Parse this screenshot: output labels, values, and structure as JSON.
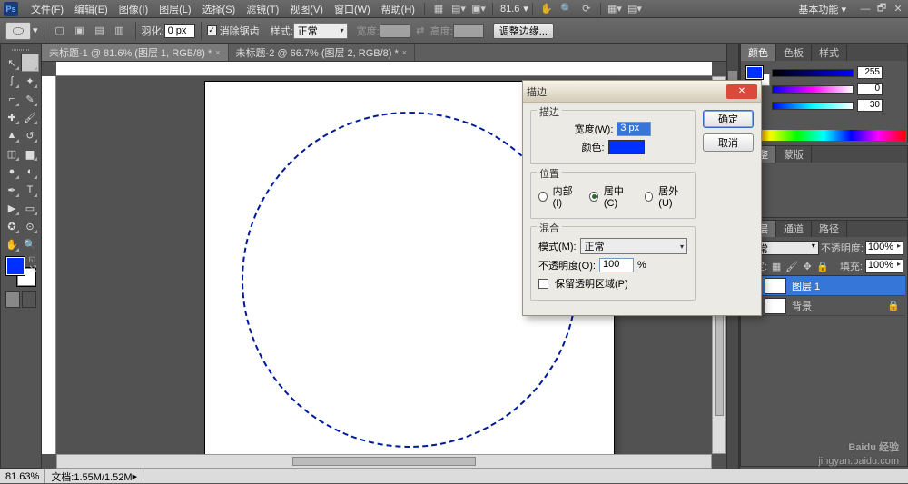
{
  "menubar": {
    "items": [
      "文件(F)",
      "编辑(E)",
      "图像(I)",
      "图层(L)",
      "选择(S)",
      "滤镜(T)",
      "视图(V)",
      "窗口(W)",
      "帮助(H)"
    ],
    "zoom": "81.6",
    "workspace_label": "基本功能"
  },
  "options": {
    "feather_label": "羽化:",
    "feather_value": "0 px",
    "antialias_checked": true,
    "antialias_label": "消除锯齿",
    "style_label": "样式:",
    "style_value": "正常",
    "width_label": "宽度:",
    "height_label": "高度:",
    "refine_btn": "调整边缘..."
  },
  "tabs": [
    {
      "label": "未标题-1 @ 81.6% (图层 1, RGB/8) *",
      "active": true
    },
    {
      "label": "未标题-2 @ 66.7% (图层 2, RGB/8) *",
      "active": false
    }
  ],
  "color_panel": {
    "tabs": [
      "颜色",
      "色板",
      "样式"
    ],
    "values": {
      "r": "0",
      "g": "30",
      "b": "255"
    }
  },
  "adjust_panel": {
    "tabs": [
      "调整",
      "蒙版"
    ]
  },
  "layers_panel": {
    "tabs": [
      "图层",
      "通道",
      "路径"
    ],
    "blend_label": "正常",
    "opacity_label": "不透明度:",
    "opacity_value": "100%",
    "lock_label": "锁定:",
    "fill_label": "填充:",
    "fill_value": "100%",
    "layers": [
      {
        "name": "图层 1",
        "selected": true,
        "locked": false
      },
      {
        "name": "背景",
        "selected": false,
        "locked": true
      }
    ]
  },
  "dialog": {
    "title": "描边",
    "ok": "确定",
    "cancel": "取消",
    "grp_stroke": "描边",
    "width_label": "宽度(W):",
    "width_value": "3 px",
    "color_label": "颜色:",
    "grp_pos": "位置",
    "pos_inside": "内部(I)",
    "pos_center": "居中(C)",
    "pos_outside": "居外(U)",
    "pos_selected": "center",
    "grp_blend": "混合",
    "mode_label": "模式(M):",
    "mode_value": "正常",
    "opacity_label": "不透明度(O):",
    "opacity_value": "100",
    "opacity_suffix": "%",
    "preserve_label": "保留透明区域(P)"
  },
  "status": {
    "zoom": "81.63%",
    "doc": "文档:1.55M/1.52M"
  },
  "watermark": {
    "main": "Baidu 经验",
    "sub": "jingyan.baidu.com"
  }
}
